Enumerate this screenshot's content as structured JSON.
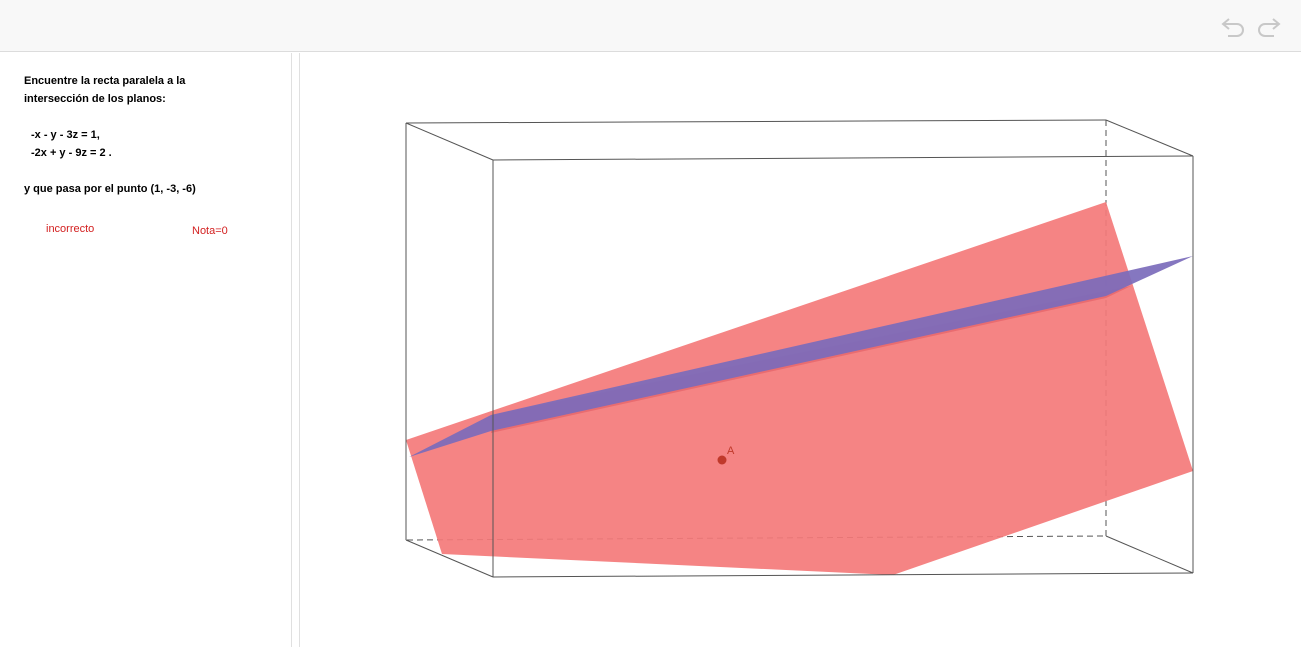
{
  "toolbar": {
    "undo_icon": "undo-icon",
    "redo_icon": "redo-icon"
  },
  "problem": {
    "line1": "Encuentre la recta paralela a la",
    "line2": "intersección de los planos:",
    "eq1": "-x - y - 3z = 1,",
    "eq2": "-2x + y - 9z = 2  .",
    "point_text": "y que pasa por el punto  (1, -3, -6)"
  },
  "feedback": {
    "status": "incorrecto",
    "grade": "Nota=0"
  },
  "graphics3d": {
    "point_label": "A",
    "plane1_color": "#f47a7a",
    "plane2_color": "#7b6bbb",
    "point_color": "#c0392b"
  }
}
